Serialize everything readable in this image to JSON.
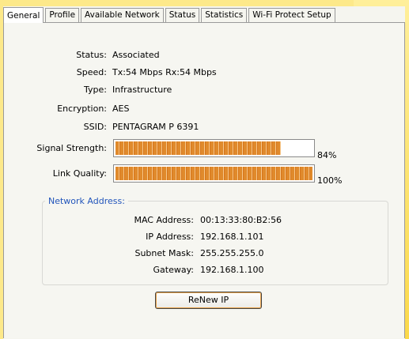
{
  "tabs": [
    "General",
    "Profile",
    "Available Network",
    "Status",
    "Statistics",
    "Wi-Fi Protect Setup"
  ],
  "info": {
    "status_label": "Status:",
    "status_value": "Associated",
    "speed_label": "Speed:",
    "speed_value": "Tx:54 Mbps Rx:54 Mbps",
    "type_label": "Type:",
    "type_value": "Infrastructure",
    "encryption_label": "Encryption:",
    "encryption_value": "AES",
    "ssid_label": "SSID:",
    "ssid_value": "PENTAGRAM P 6391"
  },
  "signal": {
    "label": "Signal Strength:",
    "value": 0.84,
    "value_text": "84%"
  },
  "link": {
    "label": "Link Quality:",
    "value": 1.0,
    "value_text": "100%"
  },
  "network": {
    "title": "Network Address:",
    "mac_label": "MAC Address:",
    "mac_value": "00:13:33:80:B2:56",
    "ip_label": "IP Address:",
    "ip_value": "192.168.1.101",
    "mask_label": "Subnet Mask:",
    "mask_value": "255.255.255.0",
    "gw_label": "Gateway:",
    "gw_value": "192.168.1.100"
  },
  "renew_button": "ReNew IP",
  "colors": {
    "bar": "#e08a2c",
    "link_title": "#2255bb",
    "background": "#fde98a"
  }
}
